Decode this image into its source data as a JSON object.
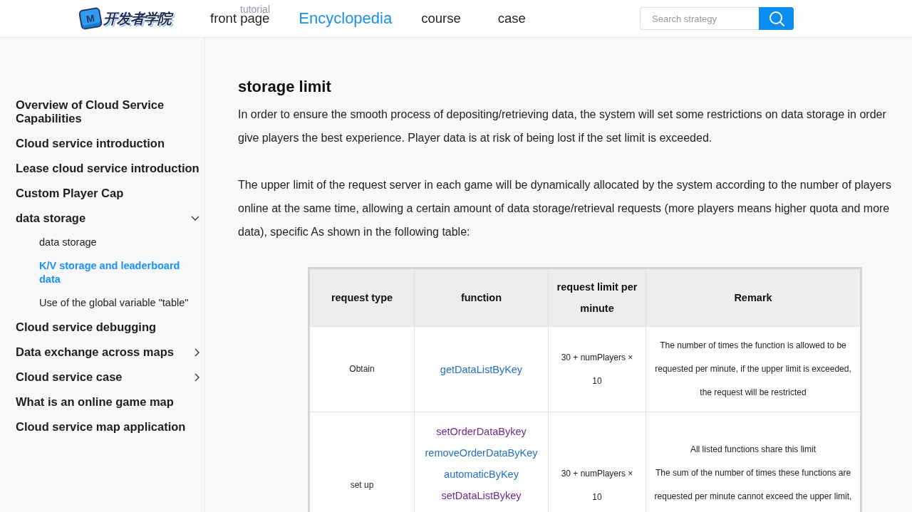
{
  "header": {
    "logo": {
      "badge": "M",
      "text": "开发者学院"
    },
    "faded_label": "tutorial",
    "nav": [
      {
        "label": "front page",
        "selected": false
      },
      {
        "label": "Encyclopedia",
        "selected": true
      },
      {
        "label": "course",
        "selected": false
      },
      {
        "label": "case",
        "selected": false
      }
    ],
    "search": {
      "placeholder": "Search strategy"
    }
  },
  "sidebar": {
    "items": [
      {
        "label": "Overview of Cloud Service Capabilities",
        "selected": false
      },
      {
        "label": "Cloud service introduction",
        "selected": false
      },
      {
        "label": "Lease cloud service introduction",
        "selected": false
      },
      {
        "label": "Custom Player Cap",
        "selected": false
      },
      {
        "label": "data storage",
        "selected": false,
        "expanded": true,
        "children": [
          {
            "label": "data storage",
            "selected": false
          },
          {
            "label": "K/V storage and leaderboard data",
            "selected": true
          },
          {
            "label": "Use of the global variable \"table\"",
            "selected": false
          }
        ]
      },
      {
        "label": "Cloud service debugging",
        "selected": false
      },
      {
        "label": "Data exchange across maps",
        "selected": false,
        "expanded": false
      },
      {
        "label": "Cloud service case",
        "selected": false,
        "expanded": false
      },
      {
        "label": "What is an online game map",
        "selected": false
      },
      {
        "label": "Cloud service map application",
        "selected": false
      }
    ]
  },
  "article": {
    "title": "storage limit",
    "paragraphs": [
      {
        "lines": [
          "In order to ensure the smooth process of depositing/retrieving data, the system will set some restrictions on data storage in order",
          "give players the best experience. Player data is at risk of being lost if the set limit is exceeded."
        ]
      },
      {
        "lines": [
          "The upper limit of the request server in each game will be dynamically allocated by the system according to the number of players",
          "online at the same time, allowing a certain amount of data storage/retrieval requests (more players means higher quota and more",
          "data), specific As shown in the following table:"
        ]
      }
    ],
    "table": {
      "columns": [
        "request type",
        "function",
        "request limit per minute",
        "Remark"
      ],
      "rows": [
        {
          "request_type": "Obtain",
          "functions": [
            {
              "name": "getDataListByKey",
              "color": "#2470c8"
            }
          ],
          "limit": "30 + numPlayers × 10",
          "remark": [
            "The number of times the function is allowed to be requested per minute, if the upper limit is exceeded, the request will be restricted"
          ]
        },
        {
          "request_type": "set up",
          "functions": [
            {
              "name": "setOrderDataBykey",
              "color": "#6a2a8c"
            },
            {
              "name": "removeOrderDataByKey",
              "color": "#2470c8"
            },
            {
              "name": "automaticByKey",
              "color": "#2470c8"
            },
            {
              "name": "setDataListBykey",
              "color": "#6a2a8c"
            }
          ],
          "limit": "30 + numPlayers × 10",
          "remark": [
            "All listed functions share this limit",
            "The sum of the number of times these functions are requested per minute cannot exceed the upper limit,"
          ]
        }
      ]
    }
  }
}
